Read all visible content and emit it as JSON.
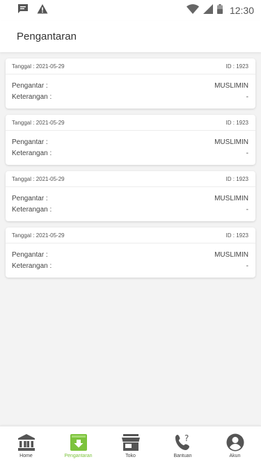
{
  "status_bar": {
    "time": "12:30",
    "icons": [
      "message-icon",
      "warning-icon",
      "wifi-icon",
      "signal-icon",
      "battery-icon"
    ]
  },
  "header": {
    "title": "Pengantaran"
  },
  "deliveries": [
    {
      "date_label": "Tanggal : 2021-05-29",
      "id_label": "ID : 1923",
      "courier_label": "Pengantar :",
      "courier_value": "MUSLIMIN",
      "note_label": "Keterangan :",
      "note_value": "-"
    },
    {
      "date_label": "Tanggal : 2021-05-29",
      "id_label": "ID : 1923",
      "courier_label": "Pengantar :",
      "courier_value": "MUSLIMIN",
      "note_label": "Keterangan :",
      "note_value": "-"
    },
    {
      "date_label": "Tanggal : 2021-05-29",
      "id_label": "ID : 1923",
      "courier_label": "Pengantar :",
      "courier_value": "MUSLIMIN",
      "note_label": "Keterangan :",
      "note_value": "-"
    },
    {
      "date_label": "Tanggal : 2021-05-29",
      "id_label": "ID : 1923",
      "courier_label": "Pengantar :",
      "courier_value": "MUSLIMIN",
      "note_label": "Keterangan :",
      "note_value": "-"
    }
  ],
  "nav": {
    "items": [
      {
        "label": "Home",
        "icon": "bank-icon"
      },
      {
        "label": "Pengantaran",
        "icon": "download-box-icon"
      },
      {
        "label": "Toko",
        "icon": "store-icon"
      },
      {
        "label": "Bantuan",
        "icon": "phone-help-icon"
      },
      {
        "label": "Akun",
        "icon": "account-icon"
      }
    ],
    "active_index": 1
  },
  "colors": {
    "accent": "#7cc33c",
    "icon": "#555555",
    "background": "#f3f3f3"
  }
}
